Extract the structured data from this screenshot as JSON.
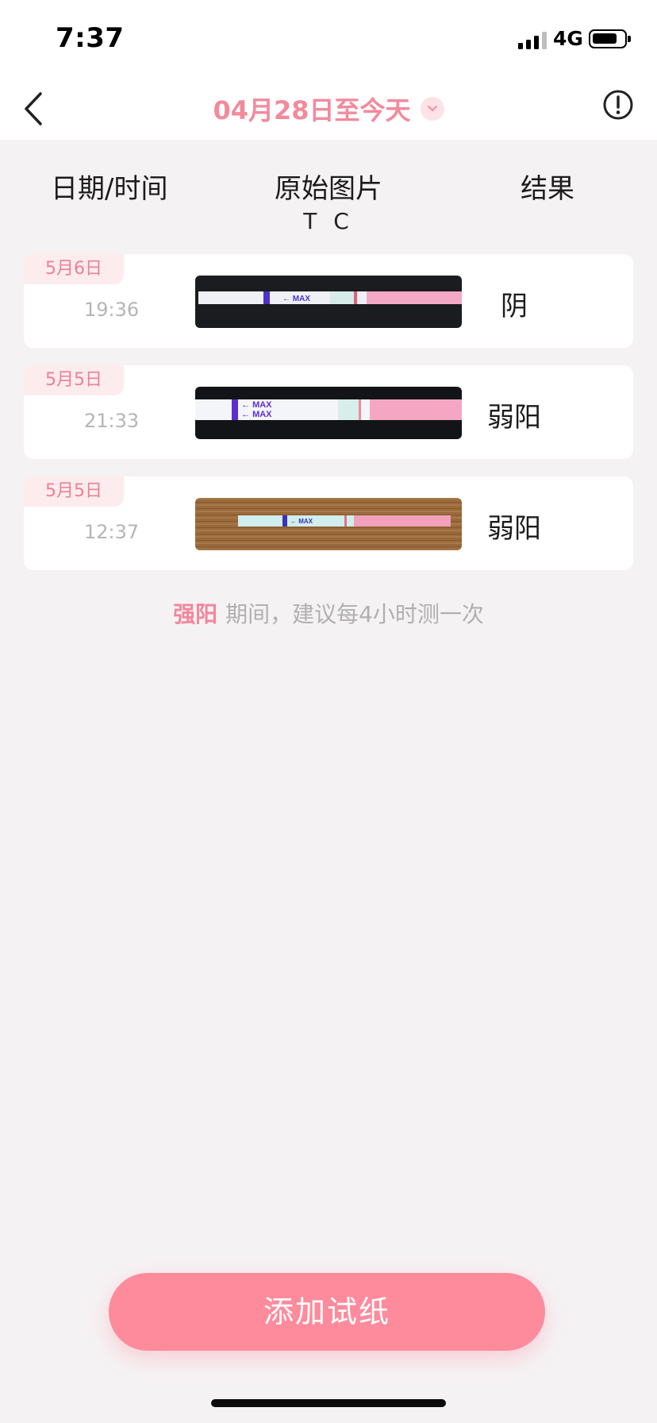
{
  "status_bar": {
    "time": "7:37",
    "network": "4G"
  },
  "nav": {
    "title": "04月28日至今天",
    "icons": {
      "back": "chevron-left-icon",
      "dropdown": "chevron-down-icon",
      "info": "exclamation-circle-icon"
    },
    "accent_color": "#f28a9c"
  },
  "table_header": {
    "date_time": "日期/时间",
    "image": "原始图片",
    "tc_label": "T C",
    "result": "结果"
  },
  "records": [
    {
      "date": "5月6日",
      "time": "19:36",
      "result": "阴",
      "strip_marking": "MAX"
    },
    {
      "date": "5月5日",
      "time": "21:33",
      "result": "弱阳",
      "strip_marking": "MAX"
    },
    {
      "date": "5月5日",
      "time": "12:37",
      "result": "弱阳",
      "strip_marking": "MAX"
    }
  ],
  "hint": {
    "highlight": "强阳",
    "text": "期间，建议每4小时测一次"
  },
  "add_button": {
    "label": "添加试纸",
    "color": "#fd8b9c"
  }
}
